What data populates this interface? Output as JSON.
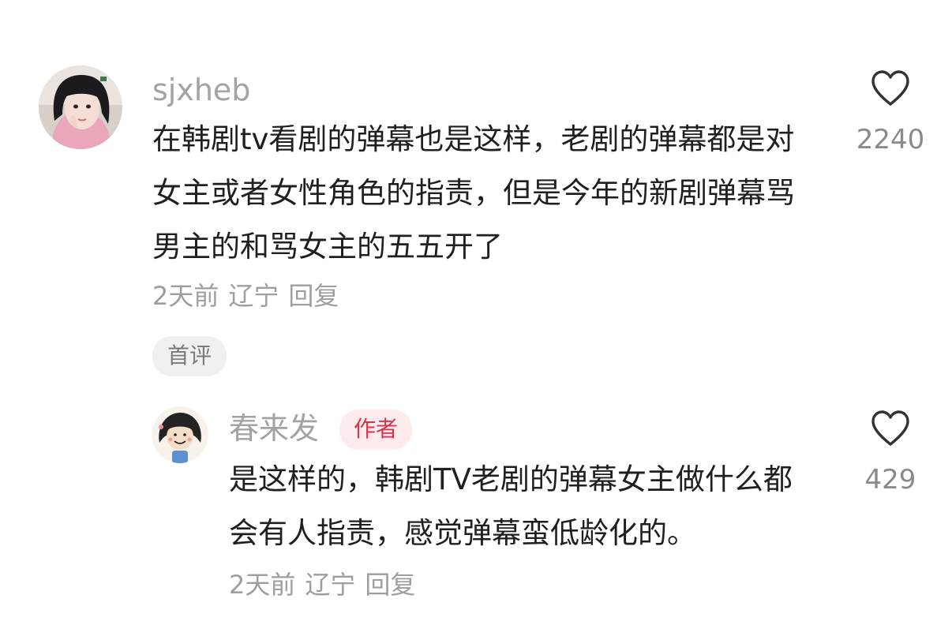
{
  "comment": {
    "username": "sjxheb",
    "content": "在韩剧tv看剧的弹幕也是这样，老剧的弹幕都是对女主或者女性角色的指责，但是今年的新剧弹幕骂男主的和骂女主的五五开了",
    "time": "2天前",
    "location": "辽宁",
    "reply_label": "回复",
    "like_count": "2240",
    "badge": "首评"
  },
  "reply": {
    "username": "春来发",
    "author_tag": "作者",
    "content": "是这样的，韩剧TV老剧的弹幕女主做什么都会有人指责，感觉弹幕蛮低龄化的。",
    "time": "2天前",
    "location": "辽宁",
    "reply_label": "回复",
    "like_count": "429"
  },
  "icons": {
    "like": "heart-outline-icon"
  },
  "colors": {
    "username": "#a3a3a3",
    "meta": "#9e9e9e",
    "author_tag_bg": "#fdebed",
    "author_tag_text": "#e0324a",
    "badge_bg": "#f0f0f0"
  }
}
